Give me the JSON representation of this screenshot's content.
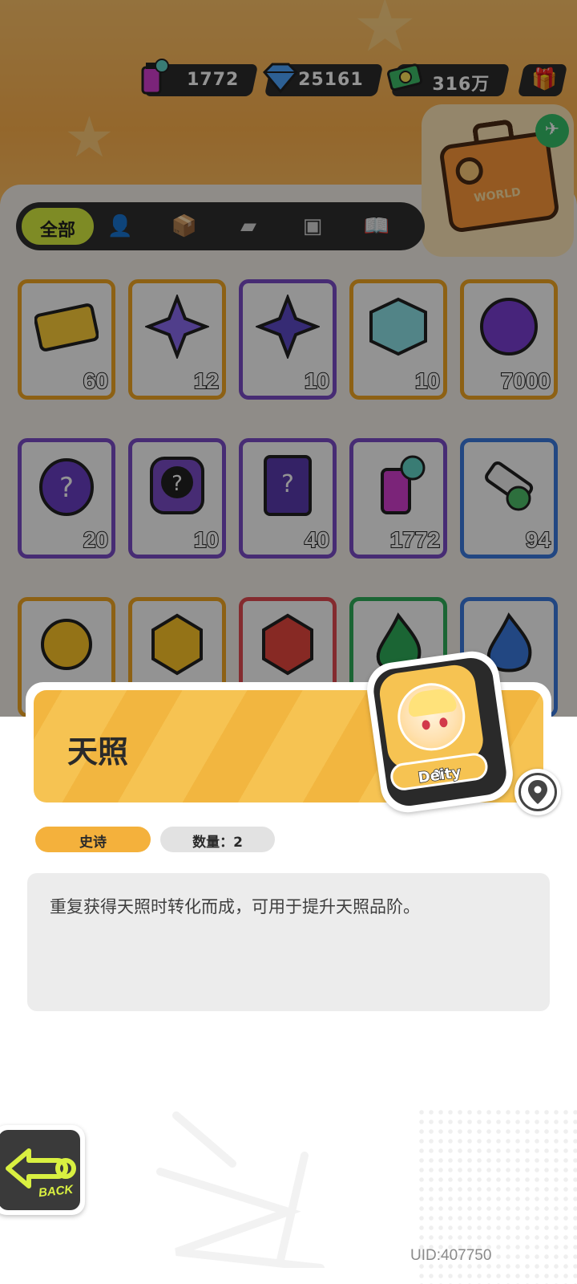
{
  "currencies": [
    {
      "name": "spray-can",
      "value": "1772"
    },
    {
      "name": "diamond",
      "value": "25161"
    },
    {
      "name": "cash",
      "value": "316万"
    }
  ],
  "world_chest": {
    "label": "WORLD"
  },
  "tabs": {
    "all_label": "全部",
    "icons": [
      "person-icon",
      "box-icon",
      "card-icon",
      "sticker-icon",
      "book-icon"
    ]
  },
  "inventory": {
    "rows": [
      [
        {
          "icon": "ticket-icon",
          "rarity": "gold",
          "count": "60"
        },
        {
          "icon": "rainbow-star-icon",
          "rarity": "gold",
          "count": "12"
        },
        {
          "icon": "purple-star-icon",
          "rarity": "purple",
          "count": "10"
        },
        {
          "icon": "cube-icon",
          "rarity": "gold",
          "count": "10"
        },
        {
          "icon": "cool-badge-icon",
          "rarity": "gold",
          "count": "7000"
        }
      ],
      [
        {
          "icon": "mystery-egg-icon",
          "rarity": "purple",
          "count": "20"
        },
        {
          "icon": "mystery-deity-icon",
          "rarity": "purple",
          "count": "10"
        },
        {
          "icon": "mystery-travel-card-icon",
          "rarity": "purple",
          "count": "40"
        },
        {
          "icon": "spray-can-icon",
          "rarity": "purple",
          "count": "1772"
        },
        {
          "icon": "paint-tube-icon",
          "rarity": "blue",
          "count": "94"
        }
      ],
      [
        {
          "icon": "gold-flower-icon",
          "rarity": "gold",
          "count": ""
        },
        {
          "icon": "gold-gem-icon",
          "rarity": "gold",
          "count": ""
        },
        {
          "icon": "red-gem-icon",
          "rarity": "red",
          "count": ""
        },
        {
          "icon": "green-flame-icon",
          "rarity": "green",
          "count": ""
        },
        {
          "icon": "blue-flame-icon",
          "rarity": "blue",
          "count": ""
        }
      ]
    ]
  },
  "detail": {
    "title": "天照",
    "badge_label": "Deity",
    "rarity": "史诗",
    "quantity": "数量：2",
    "description": "重复获得天照时转化而成，可用于提升天照品阶。"
  },
  "back_label": "BACK",
  "uid": "UID:407750",
  "colors": {
    "gold": "#f3a823",
    "purple": "#7a4cc9",
    "blue": "#3c7be0",
    "red": "#e44b52",
    "green": "#2fae5a",
    "accent_lime": "#d9f041"
  }
}
